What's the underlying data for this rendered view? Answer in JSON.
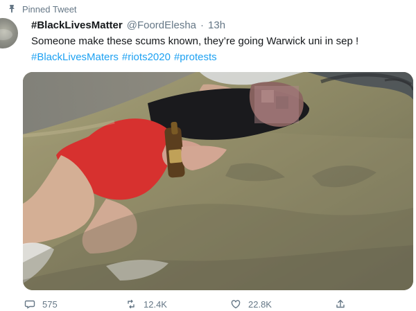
{
  "tweet": {
    "pinned_label": "Pinned Tweet",
    "display_name": "#BlackLivesMatter",
    "handle": "@FoordElesha",
    "separator": "·",
    "time": "13h",
    "text": "Someone make these scums known, they’re going Warwick uni in sep !",
    "hashtags": [
      "#BlackLivesMaters",
      "#riots2020",
      "#protests"
    ]
  },
  "actions": {
    "replies": "575",
    "retweets": "12.4K",
    "likes": "22.8K"
  },
  "icons": {
    "pin": "pin-icon",
    "reply": "reply-icon",
    "retweet": "retweet-icon",
    "like": "heart-icon",
    "share": "share-icon"
  },
  "colors": {
    "link": "#1da1f2",
    "muted": "#657786",
    "text": "#14171a"
  }
}
